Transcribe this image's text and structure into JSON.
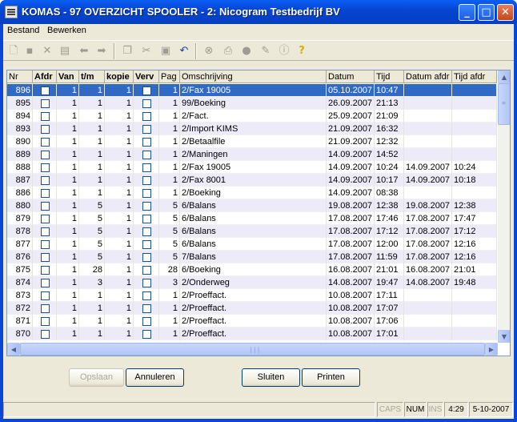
{
  "window": {
    "title": "KOMAS - 97 OVERZICHT SPOOLER - 2: Nicogram Testbedrijf BV",
    "min_label": "_",
    "max_label": "□",
    "close_label": "✕"
  },
  "menu": {
    "items": [
      {
        "label": "Bestand"
      },
      {
        "label": "Bewerken"
      }
    ]
  },
  "toolbar": {
    "icons": [
      "new-icon",
      "save-icon",
      "delete-icon",
      "edit-icon",
      "arrow-left-icon",
      "arrow-right-icon",
      "copy-icon",
      "cut-icon",
      "paste-icon",
      "undo-icon",
      "binoculars-icon",
      "print-icon",
      "stamp-icon",
      "edit-note-icon",
      "info-icon",
      "help-icon"
    ]
  },
  "table": {
    "columns": [
      "Nr",
      "Afdr",
      "Van",
      "t/m",
      "kopie",
      "Verv",
      "Pag",
      "Omschrijving",
      "Datum",
      "Tijd",
      "Datum afdr",
      "Tijd afdr"
    ],
    "rows": [
      {
        "nr": "896",
        "van": "1",
        "tm": "1",
        "kopie": "1",
        "pag": "1",
        "omschrijving": "2/Fax 19005",
        "datum": "05.10.2007",
        "tijd": "10:47",
        "datum_afdr": "",
        "tijd_afdr": ""
      },
      {
        "nr": "895",
        "van": "1",
        "tm": "1",
        "kopie": "1",
        "pag": "1",
        "omschrijving": "99/Boeking",
        "datum": "26.09.2007",
        "tijd": "21:13",
        "datum_afdr": "",
        "tijd_afdr": ""
      },
      {
        "nr": "894",
        "van": "1",
        "tm": "1",
        "kopie": "1",
        "pag": "1",
        "omschrijving": "2/Fact.",
        "datum": "25.09.2007",
        "tijd": "21:09",
        "datum_afdr": "",
        "tijd_afdr": ""
      },
      {
        "nr": "893",
        "van": "1",
        "tm": "1",
        "kopie": "1",
        "pag": "1",
        "omschrijving": "2/Import KIMS",
        "datum": "21.09.2007",
        "tijd": "16:32",
        "datum_afdr": "",
        "tijd_afdr": ""
      },
      {
        "nr": "890",
        "van": "1",
        "tm": "1",
        "kopie": "1",
        "pag": "1",
        "omschrijving": "2/Betaalfile",
        "datum": "21.09.2007",
        "tijd": "12:32",
        "datum_afdr": "",
        "tijd_afdr": ""
      },
      {
        "nr": "889",
        "van": "1",
        "tm": "1",
        "kopie": "1",
        "pag": "1",
        "omschrijving": "2/Maningen",
        "datum": "14.09.2007",
        "tijd": "14:52",
        "datum_afdr": "",
        "tijd_afdr": ""
      },
      {
        "nr": "888",
        "van": "1",
        "tm": "1",
        "kopie": "1",
        "pag": "1",
        "omschrijving": "2/Fax 19005",
        "datum": "14.09.2007",
        "tijd": "10:24",
        "datum_afdr": "14.09.2007",
        "tijd_afdr": "10:24"
      },
      {
        "nr": "887",
        "van": "1",
        "tm": "1",
        "kopie": "1",
        "pag": "1",
        "omschrijving": "2/Fax 8001",
        "datum": "14.09.2007",
        "tijd": "10:17",
        "datum_afdr": "14.09.2007",
        "tijd_afdr": "10:18"
      },
      {
        "nr": "886",
        "van": "1",
        "tm": "1",
        "kopie": "1",
        "pag": "1",
        "omschrijving": "2/Boeking",
        "datum": "14.09.2007",
        "tijd": "08:38",
        "datum_afdr": "",
        "tijd_afdr": ""
      },
      {
        "nr": "880",
        "van": "1",
        "tm": "5",
        "kopie": "1",
        "pag": "5",
        "omschrijving": "6/Balans",
        "datum": "19.08.2007",
        "tijd": "12:38",
        "datum_afdr": "19.08.2007",
        "tijd_afdr": "12:38"
      },
      {
        "nr": "879",
        "van": "1",
        "tm": "5",
        "kopie": "1",
        "pag": "5",
        "omschrijving": "6/Balans",
        "datum": "17.08.2007",
        "tijd": "17:46",
        "datum_afdr": "17.08.2007",
        "tijd_afdr": "17:47"
      },
      {
        "nr": "878",
        "van": "1",
        "tm": "5",
        "kopie": "1",
        "pag": "5",
        "omschrijving": "6/Balans",
        "datum": "17.08.2007",
        "tijd": "17:12",
        "datum_afdr": "17.08.2007",
        "tijd_afdr": "17:12"
      },
      {
        "nr": "877",
        "van": "1",
        "tm": "5",
        "kopie": "1",
        "pag": "5",
        "omschrijving": "6/Balans",
        "datum": "17.08.2007",
        "tijd": "12:00",
        "datum_afdr": "17.08.2007",
        "tijd_afdr": "12:16"
      },
      {
        "nr": "876",
        "van": "1",
        "tm": "5",
        "kopie": "1",
        "pag": "5",
        "omschrijving": "7/Balans",
        "datum": "17.08.2007",
        "tijd": "11:59",
        "datum_afdr": "17.08.2007",
        "tijd_afdr": "12:16"
      },
      {
        "nr": "875",
        "van": "1",
        "tm": "28",
        "kopie": "1",
        "pag": "28",
        "omschrijving": "6/Boeking",
        "datum": "16.08.2007",
        "tijd": "21:01",
        "datum_afdr": "16.08.2007",
        "tijd_afdr": "21:01"
      },
      {
        "nr": "874",
        "van": "1",
        "tm": "3",
        "kopie": "1",
        "pag": "3",
        "omschrijving": "2/Onderweg",
        "datum": "14.08.2007",
        "tijd": "19:47",
        "datum_afdr": "14.08.2007",
        "tijd_afdr": "19:48"
      },
      {
        "nr": "873",
        "van": "1",
        "tm": "1",
        "kopie": "1",
        "pag": "1",
        "omschrijving": "2/Proeffact.",
        "datum": "10.08.2007",
        "tijd": "17:11",
        "datum_afdr": "",
        "tijd_afdr": ""
      },
      {
        "nr": "872",
        "van": "1",
        "tm": "1",
        "kopie": "1",
        "pag": "1",
        "omschrijving": "2/Proeffact.",
        "datum": "10.08.2007",
        "tijd": "17:07",
        "datum_afdr": "",
        "tijd_afdr": ""
      },
      {
        "nr": "871",
        "van": "1",
        "tm": "1",
        "kopie": "1",
        "pag": "1",
        "omschrijving": "2/Proeffact.",
        "datum": "10.08.2007",
        "tijd": "17:06",
        "datum_afdr": "",
        "tijd_afdr": ""
      },
      {
        "nr": "870",
        "van": "1",
        "tm": "1",
        "kopie": "1",
        "pag": "1",
        "omschrijving": "2/Proeffact.",
        "datum": "10.08.2007",
        "tijd": "17:01",
        "datum_afdr": "",
        "tijd_afdr": ""
      }
    ]
  },
  "buttons": {
    "opslaan": "Opslaan",
    "annuleren": "Annuleren",
    "sluiten": "Sluiten",
    "printen": "Printen"
  },
  "statusbar": {
    "caps": "CAPS",
    "num": "NUM",
    "ins": "INS",
    "time": "4:29",
    "date": "5-10-2007"
  },
  "colors": {
    "selection": "#316ac5",
    "alt_row": "#ecebf7",
    "titlebar": "#0646d2"
  }
}
